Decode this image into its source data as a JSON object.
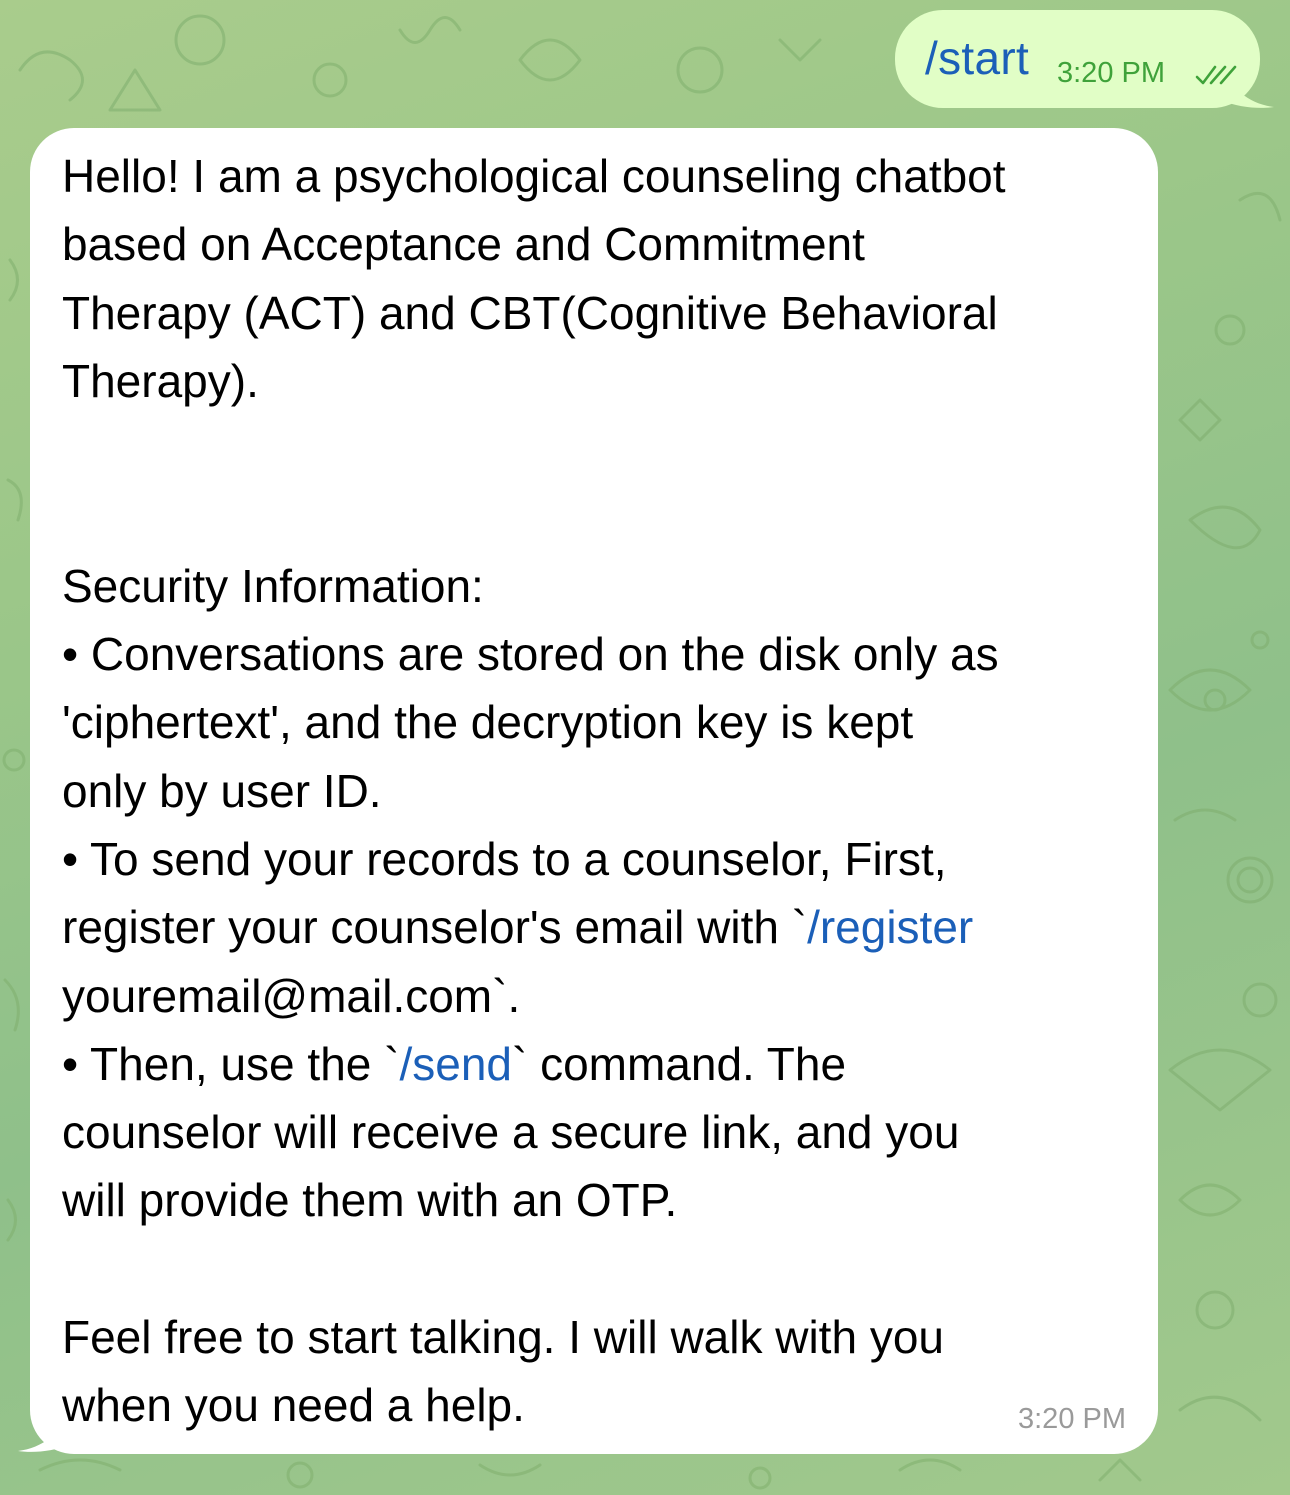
{
  "colors": {
    "wallpaper": "#9cc789",
    "outgoing_bubble": "#e1fec6",
    "incoming_bubble": "#ffffff",
    "link": "#1b5fb8",
    "outgoing_time": "#3fa23a",
    "incoming_time": "#9a9a9a"
  },
  "outgoing": {
    "text": "/start",
    "time": "3:20 PM",
    "status_icon": "double-check-icon"
  },
  "incoming": {
    "intro": [
      "Hello! I am a psychological counseling chatbot",
      "based on Acceptance and Commitment",
      "Therapy (ACT) and CBT(Cognitive Behavioral",
      "Therapy)."
    ],
    "security_heading": "Security Information:",
    "bullet1": [
      "• Conversations are stored on the disk only as",
      "'ciphertext', and the decryption key is kept",
      "only by user ID."
    ],
    "bullet2": {
      "line1": "• To send your records to a counselor, First,",
      "line2_pre": "register your counselor's email with `",
      "line2_cmd": "/register",
      "line3": "youremail@mail.com`."
    },
    "bullet3": {
      "line1_pre": "• Then, use the `",
      "line1_cmd": "/send",
      "line1_post": "` command. The",
      "line2": "counselor will receive a secure link, and you",
      "line3": "will provide them with an OTP."
    },
    "closing": [
      "Feel free to start talking. I will walk with you",
      "when you need a help."
    ],
    "time": "3:20 PM"
  }
}
